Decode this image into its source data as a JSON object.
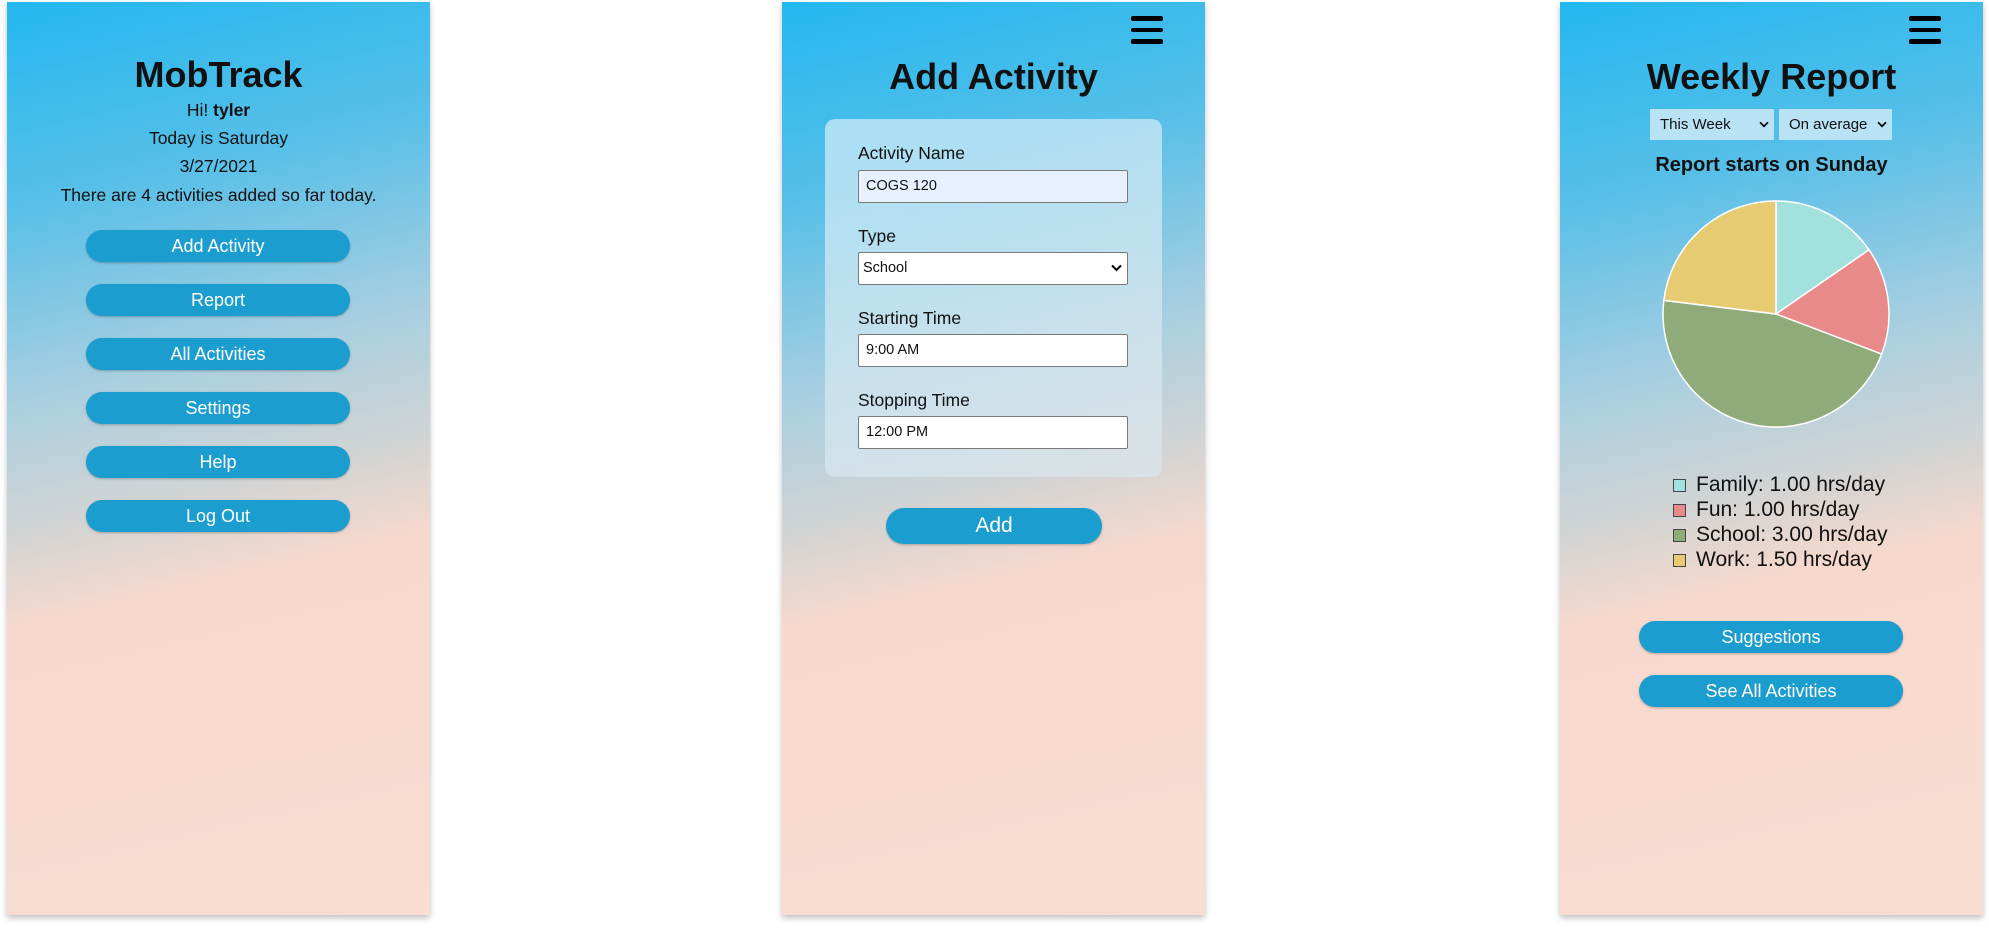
{
  "home": {
    "title": "MobTrack",
    "greeting_prefix": "Hi! ",
    "username": "tyler",
    "today_text": "Today is Saturday",
    "date": "3/27/2021",
    "activities_note": "There are 4 activities added so far today.",
    "buttons": [
      "Add Activity",
      "Report",
      "All Activities",
      "Settings",
      "Help",
      "Log Out"
    ]
  },
  "add_activity": {
    "title": "Add Activity",
    "fields": {
      "name": {
        "label": "Activity Name",
        "value": "COGS 120"
      },
      "type": {
        "label": "Type",
        "value": "School"
      },
      "start": {
        "label": "Starting Time",
        "value": "9:00 AM"
      },
      "stop": {
        "label": "Stopping Time",
        "value": "12:00 PM"
      }
    },
    "submit_label": "Add"
  },
  "report": {
    "title": "Weekly Report",
    "period_select": "This Week",
    "mode_select": "On average",
    "start_note": "Report starts on Sunday",
    "suggestions_label": "Suggestions",
    "see_all_label": "See All Activities"
  },
  "colors": {
    "accent": "#1b9dcf",
    "family": "#a3e1df",
    "fun": "#e88a89",
    "school": "#8fab79",
    "work": "#e7cb72"
  },
  "chart_data": {
    "type": "pie",
    "title": "",
    "unit": "hrs/day",
    "legend_position": "bottom",
    "series": [
      {
        "name": "Family",
        "value": 1.0,
        "label": "Family: 1.00 hrs/day"
      },
      {
        "name": "Fun",
        "value": 1.0,
        "label": "Fun: 1.00 hrs/day"
      },
      {
        "name": "School",
        "value": 3.0,
        "label": "School: 3.00 hrs/day"
      },
      {
        "name": "Work",
        "value": 1.5,
        "label": "Work: 1.50 hrs/day"
      }
    ]
  }
}
